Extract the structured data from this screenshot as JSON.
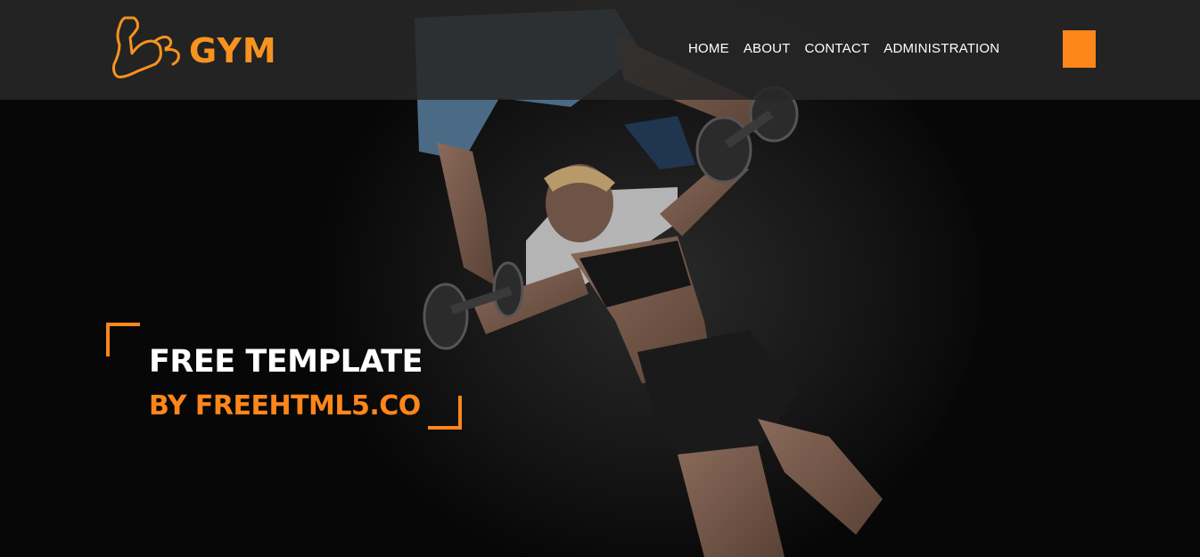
{
  "brand": {
    "logo_text": "GYM",
    "logo_icon": "flexed-arm-icon",
    "accent_color": "#ff861a"
  },
  "nav": {
    "items": [
      {
        "label": "HOME"
      },
      {
        "label": "ABOUT"
      },
      {
        "label": "CONTACT"
      },
      {
        "label": "ADMINISTRATION"
      }
    ],
    "menu_button_icon": "menu-square-icon"
  },
  "hero": {
    "title": "FREE TEMPLATE",
    "subtitle": "BY FREEHTML5.CO",
    "background_image": "trainer spotting woman doing dumbbell press on bench, top-down view"
  }
}
